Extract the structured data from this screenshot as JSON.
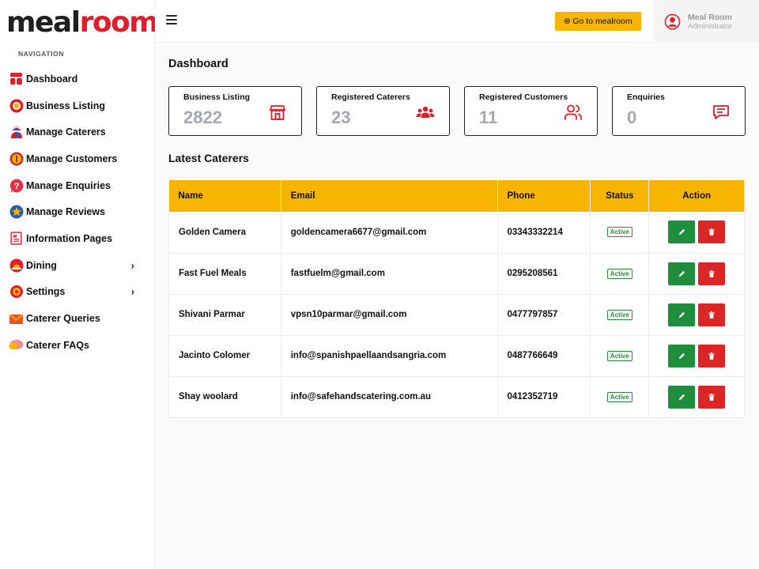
{
  "brand": {
    "logo_part1": "meal",
    "logo_part2": "room"
  },
  "sidebar": {
    "heading": "NAVIGATION",
    "items": [
      {
        "label": "Dashboard",
        "icon": "dashboard-icon"
      },
      {
        "label": "Business Listing",
        "icon": "plate-icon"
      },
      {
        "label": "Manage Caterers",
        "icon": "chef-icon"
      },
      {
        "label": "Manage Customers",
        "icon": "customer-icon"
      },
      {
        "label": "Manage Enquiries",
        "icon": "question-icon"
      },
      {
        "label": "Manage Reviews",
        "icon": "star-icon"
      },
      {
        "label": "Information Pages",
        "icon": "document-icon"
      },
      {
        "label": "Dining",
        "icon": "dining-icon",
        "has_submenu": true
      },
      {
        "label": "Settings",
        "icon": "gear-icon",
        "has_submenu": true
      },
      {
        "label": "Caterer Queries",
        "icon": "mail-icon"
      },
      {
        "label": "Caterer FAQs",
        "icon": "faq-icon"
      }
    ]
  },
  "topbar": {
    "go_button_label": "Go to mealroom",
    "user_name": "Meal Room",
    "user_role": "Administrator"
  },
  "main": {
    "title": "Dashboard",
    "cards": [
      {
        "label": "Business Listing",
        "value": "2822",
        "icon": "store-icon"
      },
      {
        "label": "Registered Caterers",
        "value": "23",
        "icon": "group-icon"
      },
      {
        "label": "Registered Customers",
        "value": "11",
        "icon": "users-icon"
      },
      {
        "label": "Enquiries",
        "value": "0",
        "icon": "message-icon"
      }
    ],
    "section_title": "Latest Caterers",
    "table": {
      "columns": [
        "Name",
        "Email",
        "Phone",
        "Status",
        "Action"
      ],
      "rows": [
        {
          "name": "Golden Camera",
          "email": "goldencamera6677@gmail.com",
          "phone": "03343332214",
          "status": "Active"
        },
        {
          "name": "Fast Fuel Meals",
          "email": "fastfuelm@gmail.com",
          "phone": "0295208561",
          "status": "Active"
        },
        {
          "name": "Shivani Parmar",
          "email": "vpsn10parmar@gmail.com",
          "phone": "0477797857",
          "status": "Active"
        },
        {
          "name": "Jacinto Colomer",
          "email": "info@spanishpaellaandsangria.com",
          "phone": "0487766649",
          "status": "Active"
        },
        {
          "name": "Shay woolard",
          "email": "info@safehandscatering.com.au",
          "phone": "0412352719",
          "status": "Active"
        }
      ]
    }
  },
  "colors": {
    "accent": "#f7b500",
    "brand_red": "#e21d2a",
    "edit": "#1e8d3c",
    "delete": "#dc2626",
    "active": "#2a8a3c"
  }
}
